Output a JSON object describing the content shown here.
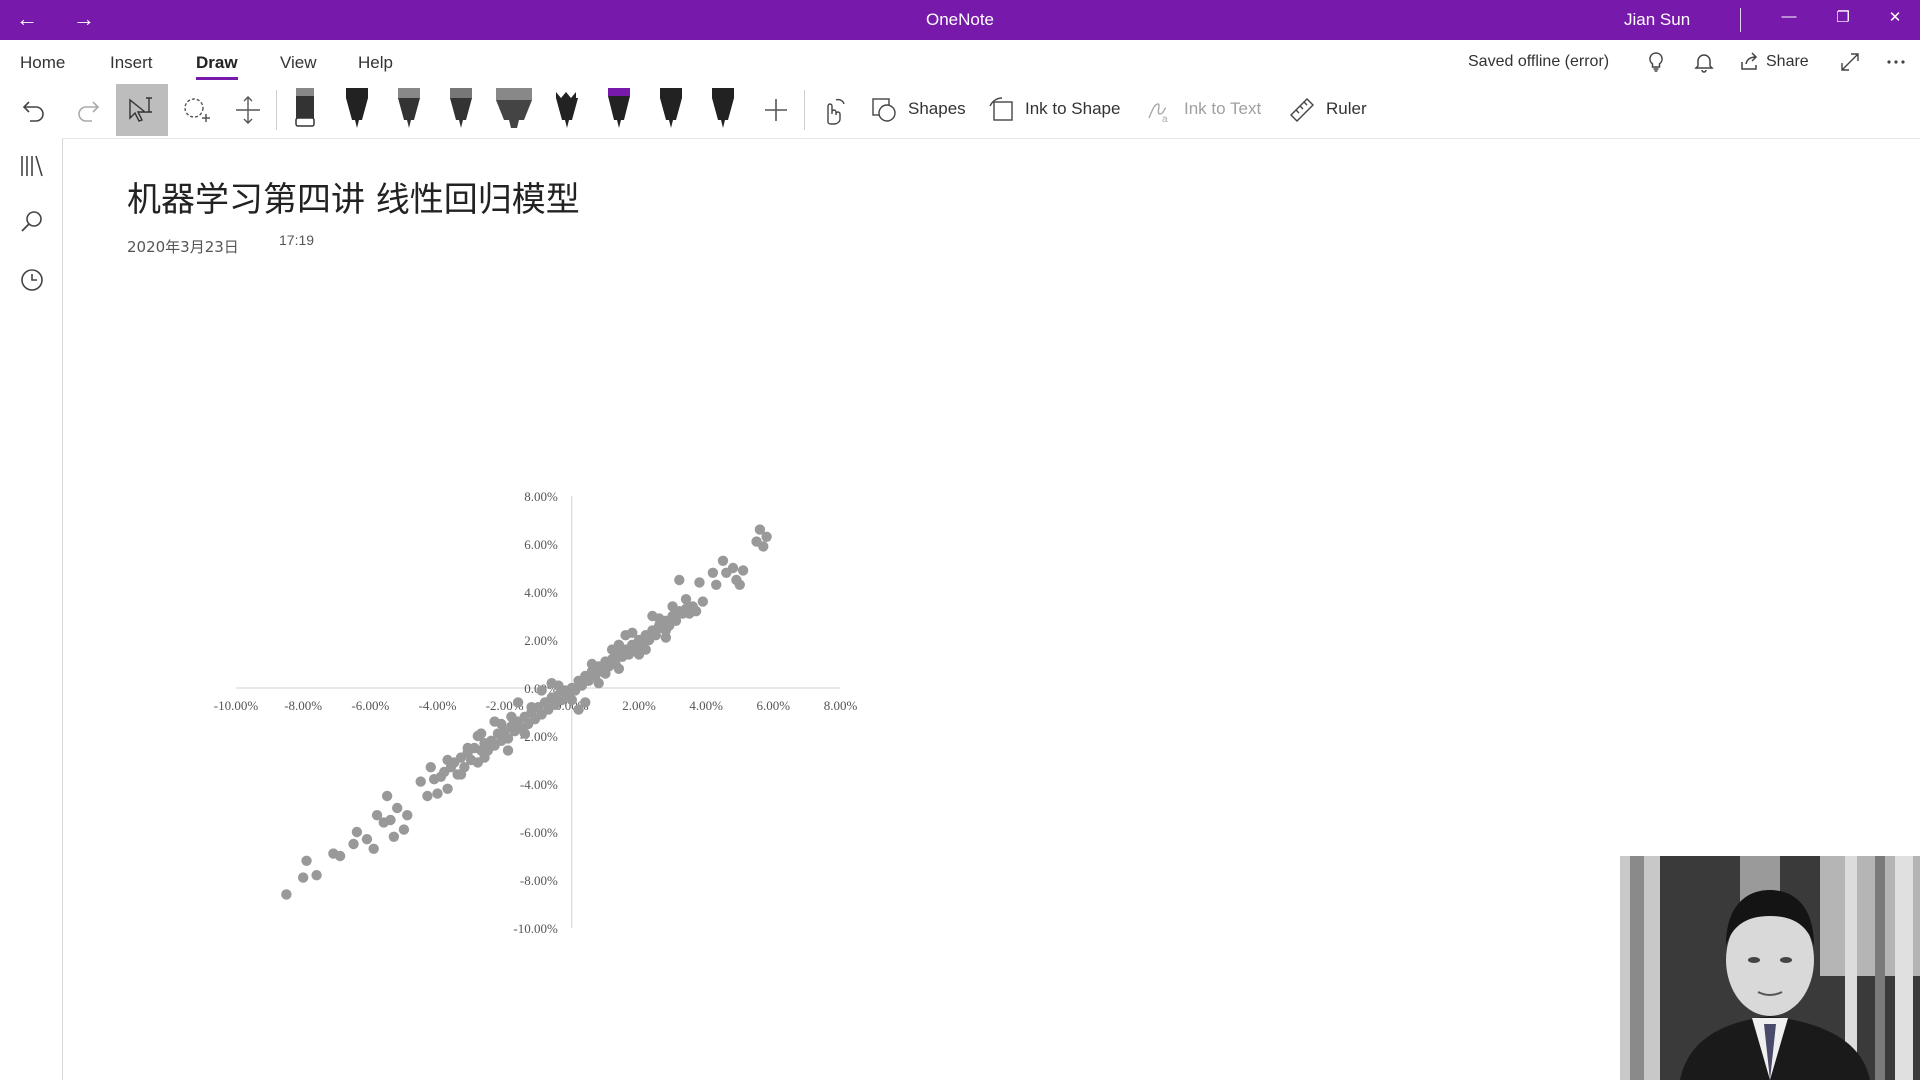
{
  "titlebar": {
    "app_title": "OneNote",
    "user_name": "Jian Sun",
    "back_glyph": "←",
    "forward_glyph": "→",
    "minimize_glyph": "—",
    "restore_glyph": "❐",
    "close_glyph": "✕"
  },
  "menu": {
    "tabs": [
      "Home",
      "Insert",
      "Draw",
      "View",
      "Help"
    ],
    "active_tab": "Draw",
    "status": "Saved offline (error)",
    "share_label": "Share"
  },
  "toolbar": {
    "shapes_label": "Shapes",
    "ink_to_shape_label": "Ink to Shape",
    "ink_to_text_label": "Ink to Text",
    "ruler_label": "Ruler",
    "pen_colors": [
      "#333333",
      "#222222",
      "#333333",
      "#333333",
      "#444444",
      "#222222",
      "#7719aa",
      "#222222",
      "#222222"
    ]
  },
  "page": {
    "title": "机器学习第四讲 线性回归模型",
    "date": "2020年3月23日",
    "time": "17:19"
  },
  "chart_data": {
    "type": "scatter",
    "x_ticks": [
      "-10.00%",
      "-8.00%",
      "-6.00%",
      "-4.00%",
      "-2.00%",
      "0.00%",
      "2.00%",
      "4.00%",
      "6.00%",
      "8.00%"
    ],
    "y_ticks": [
      "8.00%",
      "6.00%",
      "4.00%",
      "2.00%",
      "0.00%",
      "-2.00%",
      "-4.00%",
      "-6.00%",
      "-8.00%",
      "-10.00%"
    ],
    "xlim": [
      -10,
      8
    ],
    "ylim": [
      -10,
      8
    ],
    "marker_color": "#999999",
    "points": [
      [
        -8.5,
        -8.6
      ],
      [
        -8.0,
        -7.9
      ],
      [
        -7.9,
        -7.2
      ],
      [
        -7.6,
        -7.8
      ],
      [
        -7.1,
        -6.9
      ],
      [
        -6.9,
        -7.0
      ],
      [
        -6.5,
        -6.5
      ],
      [
        -6.4,
        -6.0
      ],
      [
        -6.1,
        -6.3
      ],
      [
        -5.9,
        -6.7
      ],
      [
        -5.8,
        -5.3
      ],
      [
        -5.6,
        -5.6
      ],
      [
        -5.5,
        -4.5
      ],
      [
        -5.4,
        -5.5
      ],
      [
        -5.3,
        -6.2
      ],
      [
        -5.2,
        -5.0
      ],
      [
        -5.0,
        -5.9
      ],
      [
        -4.9,
        -5.3
      ],
      [
        -4.5,
        -3.9
      ],
      [
        -4.3,
        -4.5
      ],
      [
        -4.1,
        -3.8
      ],
      [
        -4.0,
        -4.4
      ],
      [
        -3.9,
        -3.7
      ],
      [
        -3.8,
        -3.5
      ],
      [
        -3.7,
        -4.2
      ],
      [
        -3.6,
        -3.3
      ],
      [
        -3.5,
        -3.1
      ],
      [
        -3.4,
        -3.6
      ],
      [
        -3.3,
        -2.9
      ],
      [
        -3.2,
        -3.3
      ],
      [
        -3.1,
        -2.7
      ],
      [
        -3.0,
        -3.0
      ],
      [
        -2.9,
        -2.5
      ],
      [
        -2.8,
        -3.1
      ],
      [
        -2.7,
        -2.6
      ],
      [
        -2.6,
        -2.3
      ],
      [
        -2.5,
        -2.6
      ],
      [
        -2.4,
        -2.2
      ],
      [
        -2.3,
        -2.4
      ],
      [
        -2.2,
        -1.9
      ],
      [
        -2.1,
        -2.2
      ],
      [
        -2.0,
        -1.8
      ],
      [
        -1.9,
        -2.1
      ],
      [
        -1.8,
        -1.6
      ],
      [
        -1.7,
        -1.8
      ],
      [
        -1.6,
        -1.4
      ],
      [
        -1.5,
        -1.7
      ],
      [
        -1.4,
        -1.2
      ],
      [
        -1.3,
        -1.5
      ],
      [
        -1.2,
        -1.0
      ],
      [
        -1.1,
        -1.3
      ],
      [
        -1.0,
        -0.8
      ],
      [
        -0.9,
        -1.1
      ],
      [
        -0.8,
        -0.6
      ],
      [
        -0.7,
        -0.9
      ],
      [
        -0.6,
        -0.4
      ],
      [
        -0.5,
        -0.7
      ],
      [
        -0.4,
        -0.3
      ],
      [
        -0.3,
        -0.5
      ],
      [
        -0.2,
        -0.1
      ],
      [
        -0.1,
        -0.3
      ],
      [
        0.0,
        0.0
      ],
      [
        0.1,
        -0.1
      ],
      [
        0.2,
        0.3
      ],
      [
        0.3,
        0.1
      ],
      [
        0.4,
        0.5
      ],
      [
        0.5,
        0.3
      ],
      [
        0.6,
        0.7
      ],
      [
        0.7,
        0.5
      ],
      [
        0.8,
        0.9
      ],
      [
        0.9,
        0.7
      ],
      [
        1.0,
        1.1
      ],
      [
        1.1,
        0.9
      ],
      [
        1.2,
        1.2
      ],
      [
        1.3,
        1.0
      ],
      [
        1.4,
        1.4
      ],
      [
        1.5,
        1.3
      ],
      [
        1.6,
        1.6
      ],
      [
        1.7,
        1.4
      ],
      [
        1.8,
        1.8
      ],
      [
        1.9,
        1.6
      ],
      [
        2.0,
        2.0
      ],
      [
        2.1,
        1.8
      ],
      [
        2.2,
        2.2
      ],
      [
        2.3,
        2.0
      ],
      [
        2.4,
        2.4
      ],
      [
        2.5,
        2.2
      ],
      [
        2.6,
        2.6
      ],
      [
        2.7,
        2.5
      ],
      [
        2.8,
        2.8
      ],
      [
        2.9,
        2.6
      ],
      [
        3.0,
        3.0
      ],
      [
        3.1,
        2.8
      ],
      [
        3.2,
        3.2
      ],
      [
        3.3,
        3.1
      ],
      [
        3.4,
        3.3
      ],
      [
        3.5,
        3.1
      ],
      [
        3.6,
        3.4
      ],
      [
        3.7,
        3.2
      ],
      [
        -1.8,
        -1.2
      ],
      [
        -1.6,
        -0.6
      ],
      [
        -1.2,
        -0.8
      ],
      [
        -0.6,
        0.2
      ],
      [
        -2.3,
        -1.4
      ],
      [
        -2.7,
        -1.9
      ],
      [
        0.4,
        -0.6
      ],
      [
        0.2,
        -0.9
      ],
      [
        1.2,
        1.6
      ],
      [
        1.6,
        2.2
      ],
      [
        2.4,
        3.0
      ],
      [
        3.0,
        3.4
      ],
      [
        2.8,
        2.4
      ],
      [
        2.2,
        1.6
      ],
      [
        -0.9,
        -0.1
      ],
      [
        -1.4,
        -1.9
      ],
      [
        -1.9,
        -2.6
      ],
      [
        -2.6,
        -2.9
      ],
      [
        -3.3,
        -3.6
      ],
      [
        0.6,
        1.0
      ],
      [
        1.0,
        0.6
      ],
      [
        0.0,
        -0.5
      ],
      [
        -0.4,
        0.1
      ],
      [
        3.2,
        4.5
      ],
      [
        3.8,
        4.4
      ],
      [
        4.2,
        4.8
      ],
      [
        4.3,
        4.3
      ],
      [
        4.5,
        5.3
      ],
      [
        4.6,
        4.8
      ],
      [
        4.8,
        5.0
      ],
      [
        4.9,
        4.5
      ],
      [
        5.0,
        4.3
      ],
      [
        5.1,
        4.9
      ],
      [
        5.5,
        6.1
      ],
      [
        5.6,
        6.6
      ],
      [
        5.8,
        6.3
      ],
      [
        5.7,
        5.9
      ],
      [
        -3.1,
        -2.5
      ],
      [
        -2.8,
        -2.0
      ],
      [
        -3.7,
        -3.0
      ],
      [
        -4.2,
        -3.3
      ],
      [
        -2.1,
        -1.5
      ],
      [
        1.4,
        1.8
      ],
      [
        1.8,
        2.3
      ],
      [
        2.6,
        2.9
      ],
      [
        3.4,
        3.7
      ],
      [
        3.9,
        3.6
      ],
      [
        2.0,
        1.4
      ],
      [
        2.8,
        2.1
      ],
      [
        1.4,
        0.8
      ],
      [
        0.8,
        0.2
      ]
    ]
  }
}
